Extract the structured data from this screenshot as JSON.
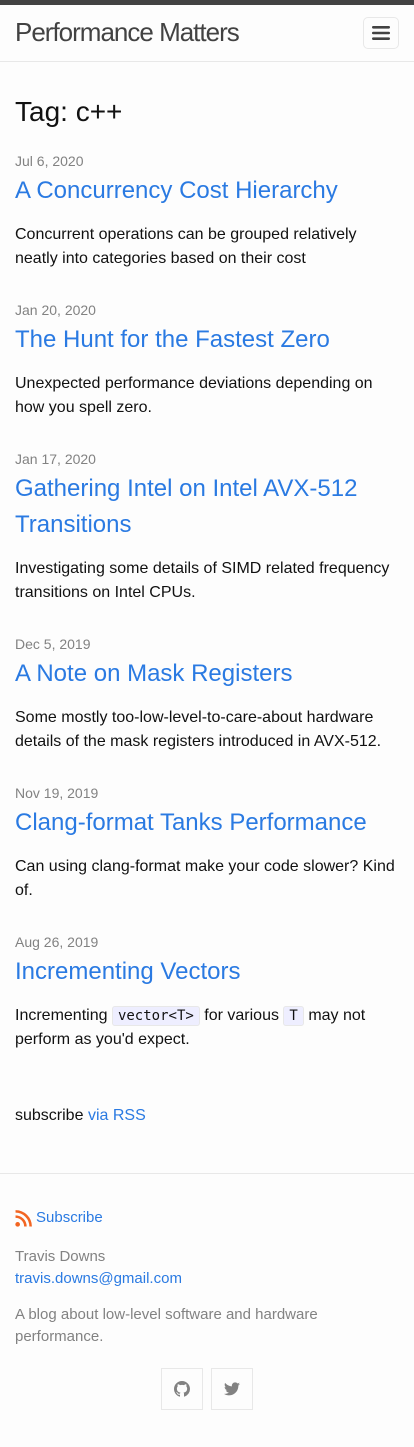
{
  "site": {
    "title": "Performance Matters"
  },
  "page": {
    "heading": "Tag: c++"
  },
  "posts": [
    {
      "date": "Jul 6, 2020",
      "title": "A Concurrency Cost Hierarchy",
      "excerpt": "Concurrent operations can be grouped relatively neatly into categories based on their cost"
    },
    {
      "date": "Jan 20, 2020",
      "title": "The Hunt for the Fastest Zero",
      "excerpt": "Unexpected performance deviations depending on how you spell zero."
    },
    {
      "date": "Jan 17, 2020",
      "title": "Gathering Intel on Intel AVX-512 Transitions",
      "excerpt": "Investigating some details of SIMD related frequency transitions on Intel CPUs."
    },
    {
      "date": "Dec 5, 2019",
      "title": "A Note on Mask Registers",
      "excerpt": "Some mostly too-low-level-to-care-about hardware details of the mask registers introduced in AVX-512."
    },
    {
      "date": "Nov 19, 2019",
      "title": "Clang-format Tanks Performance",
      "excerpt": "Can using clang-format make your code slower? Kind of."
    },
    {
      "date": "Aug 26, 2019",
      "title": "Incrementing Vectors",
      "excerpt_pre": "Incrementing",
      "excerpt_code1": "vector<T>",
      "excerpt_mid": "for various",
      "excerpt_code2": "T",
      "excerpt_post": "may not perform as you'd expect."
    }
  ],
  "subscribe": {
    "prefix": "subscribe",
    "link": "via RSS"
  },
  "footer": {
    "subscribe_label": "Subscribe",
    "author": "Travis Downs",
    "email": "travis.downs@gmail.com",
    "description": "A blog about low-level software and hardware performance.",
    "icons": {
      "rss": "rss-icon",
      "github": "github-icon",
      "twitter": "twitter-icon"
    }
  },
  "colors": {
    "link": "#2a7ae2",
    "meta": "#828282",
    "rss": "#f26522",
    "topbar": "#424242"
  }
}
